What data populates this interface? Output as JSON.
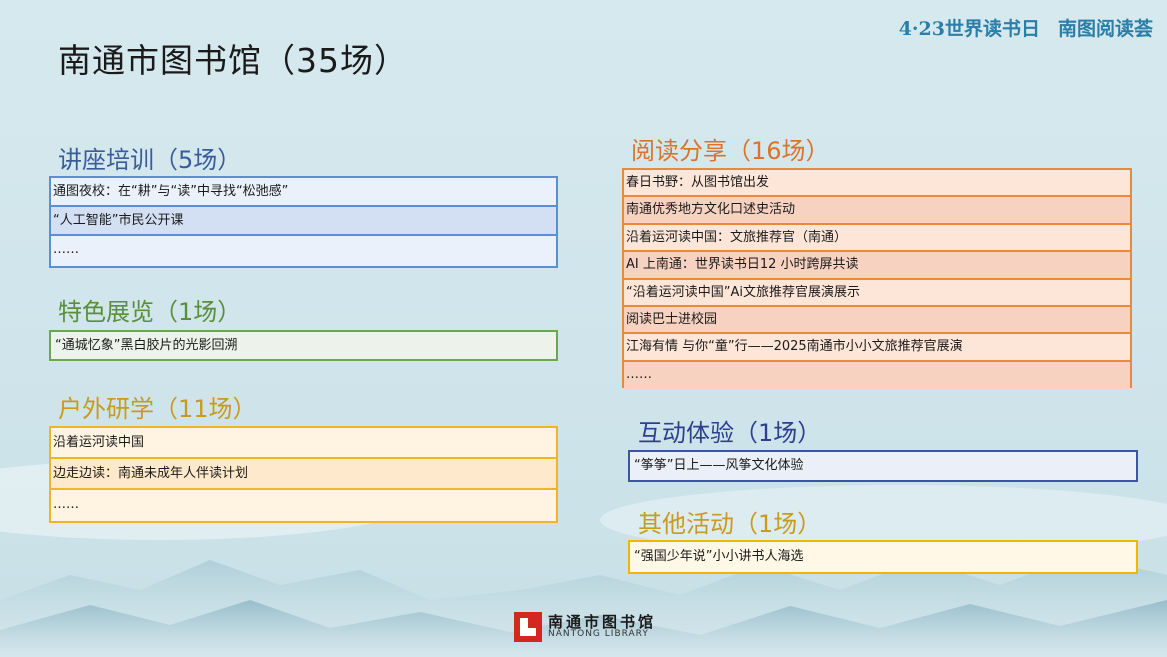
{
  "header": {
    "title": "南通市图书馆（35场）",
    "slogan_left": "4·23世界读书日",
    "slogan_right": "南图阅读荟"
  },
  "sections": {
    "lectures": {
      "title": "讲座培训（5场）",
      "items": [
        "通图夜校：在“耕”与“读”中寻找“松弛感”",
        "“人工智能”市民公开课",
        "……"
      ]
    },
    "exhibitions": {
      "title": "特色展览（1场）",
      "items": [
        "“通城忆象”黑白胶片的光影回溯"
      ]
    },
    "outdoor": {
      "title": "户外研学（11场）",
      "items": [
        "沿着运河读中国",
        "边走边读：南通未成年人伴读计划",
        "……"
      ]
    },
    "reading": {
      "title": "阅读分享（16场）",
      "items": [
        "春日书野：从图书馆出发",
        "南通优秀地方文化口述史活动",
        "沿着运河读中国：文旅推荐官（南通）",
        "AI 上南通：世界读书日12 小时跨屏共读",
        "“沿着运河读中国”Ai文旅推荐官展演展示",
        "阅读巴士进校园",
        "江海有情 与你“童”行——2025南通市小小文旅推荐官展演",
        "……"
      ]
    },
    "interactive": {
      "title": "互动体验（1场）",
      "items": [
        "“筝筝”日上——风筝文化体验"
      ]
    },
    "other": {
      "title": "其他活动（1场）",
      "items": [
        "“强国少年说”小小讲书人海选"
      ]
    }
  },
  "logo": {
    "name_cn": "南通市图书馆",
    "name_en": "NANTONG LIBRARY",
    "icon": "library-logo-icon",
    "color": "#d2281f"
  },
  "colors": {
    "blue": "#5b8fcf",
    "green": "#6aa84f",
    "gold": "#f0b429",
    "orange": "#e88a3a",
    "navy": "#3a55a6",
    "yellow": "#f2b600"
  }
}
